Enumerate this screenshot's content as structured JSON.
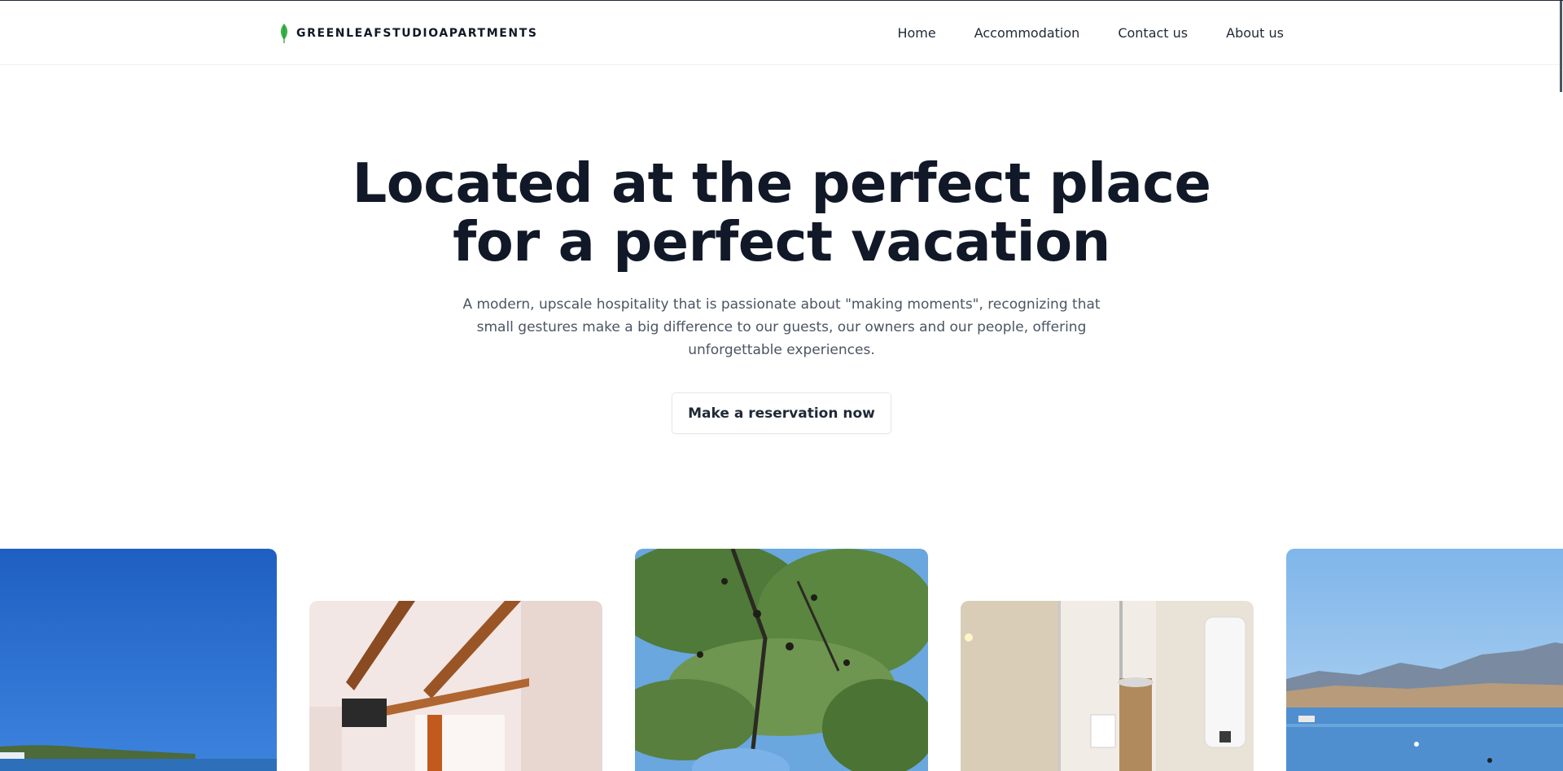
{
  "brand": {
    "name": "GREENLEAFSTUDIOAPARTMENTS",
    "logo_icon": "leaf-icon",
    "logo_color": "#3bb54a"
  },
  "nav": {
    "items": [
      {
        "label": "Home"
      },
      {
        "label": "Accommodation"
      },
      {
        "label": "Contact us"
      },
      {
        "label": "About us"
      }
    ]
  },
  "hero": {
    "title_line1": "Located at the perfect place",
    "title_line2": "for a perfect vacation",
    "subtitle": "A modern, upscale hospitality that is passionate about \"making moments\", recognizing that small gestures make a big difference to our guests, our owners and our people, offering unforgettable experiences.",
    "cta_label": "Make a reservation now"
  },
  "gallery": {
    "photos": [
      {
        "subject": "sea-coast-blue-sky-photo"
      },
      {
        "subject": "bedroom-wooden-beams-photo"
      },
      {
        "subject": "pine-tree-canopy-photo"
      },
      {
        "subject": "bathroom-glass-shower-photo"
      },
      {
        "subject": "harbor-town-mountains-photo"
      }
    ]
  },
  "colors": {
    "text_dark": "#111827",
    "text_muted": "#4b5563",
    "accent": "#3bb54a"
  }
}
